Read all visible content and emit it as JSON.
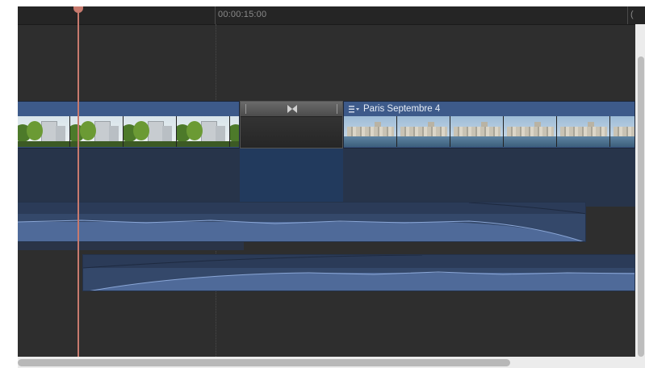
{
  "ruler": {
    "timecode_label": "00:00:15:00",
    "cut_label": "("
  },
  "video_track": {
    "clip_left": {
      "thumbnail": "trees-and-building",
      "frame_count": 5
    },
    "transition": {
      "icon": "cross-dissolve-icon"
    },
    "clip_right": {
      "title": "Paris Septembre 4",
      "icon": "clip-menu-icon",
      "thumbnail": "seine-river-skyline",
      "frame_count": 6
    }
  },
  "audio_tracks": [
    {
      "name": "audio-waveform-primary",
      "color": "#34486a"
    },
    {
      "name": "audio-waveform-secondary",
      "color": "#34486a"
    }
  ],
  "playhead": {
    "color": "#c87a6e"
  },
  "colors": {
    "timeline_bg": "#2e2e2e",
    "clip_blue": "#35507c",
    "clip_header": "#3d5a8a",
    "waveform": "#6f8fc2"
  }
}
